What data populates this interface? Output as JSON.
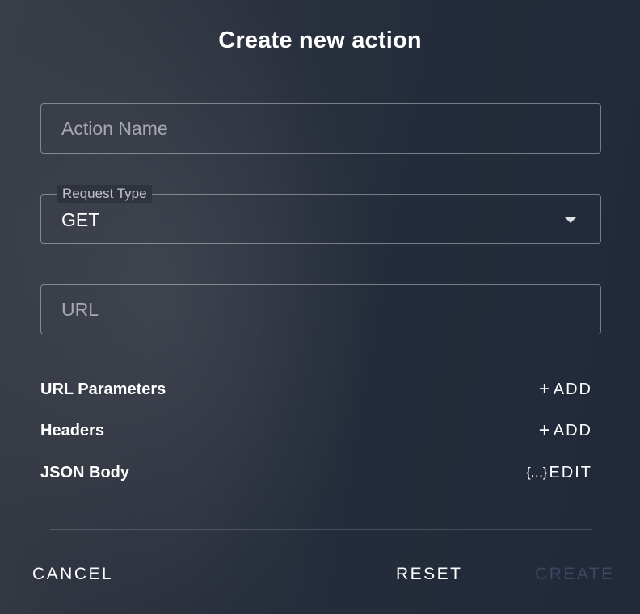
{
  "dialog": {
    "title": "Create new action"
  },
  "form": {
    "action_name": {
      "placeholder": "Action Name",
      "value": ""
    },
    "request_type": {
      "label": "Request Type",
      "value": "GET"
    },
    "url": {
      "placeholder": "URL",
      "value": ""
    }
  },
  "sections": {
    "url_parameters": {
      "label": "URL Parameters",
      "action_icon": "+",
      "action_label": "ADD"
    },
    "headers": {
      "label": "Headers",
      "action_icon": "+",
      "action_label": "ADD"
    },
    "json_body": {
      "label": "JSON Body",
      "action_icon": "{…}",
      "action_label": "EDIT"
    }
  },
  "footer": {
    "cancel_label": "CANCEL",
    "reset_label": "RESET",
    "create_label": "CREATE",
    "create_disabled": true
  },
  "colors": {
    "background": "#252d3c",
    "text": "#ffffff",
    "disabled_text": "#3a4863",
    "field_border": "#7d828c"
  }
}
